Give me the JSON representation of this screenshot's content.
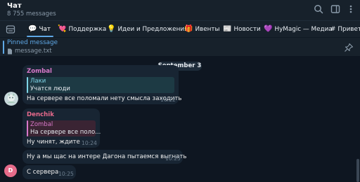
{
  "header": {
    "title": "Чат",
    "subtitle": "8 755 messages",
    "icons": [
      "search-icon",
      "sidebar-toggle-icon",
      "more-vertical-icon"
    ]
  },
  "tabs": {
    "items": [
      {
        "emoji": "💬",
        "label": "Чат"
      },
      {
        "emoji": "💘",
        "label": "Поддержка"
      },
      {
        "emoji": "💡",
        "label": "Идеи и Предложения"
      },
      {
        "emoji": "🎁",
        "label": "Ивенты"
      },
      {
        "emoji": "📰",
        "label": "Новости"
      },
      {
        "emoji": "💜",
        "label": "HyMagic — Медиа"
      },
      {
        "emoji": "#",
        "label": "Привет!"
      }
    ]
  },
  "pinned": {
    "title": "Pinned message",
    "text": "message.txt"
  },
  "chat": {
    "date": "September 3",
    "messages": [
      {
        "sender": "Zombal",
        "reply_name": "Лаки",
        "reply_text": "Учатся люди",
        "text": "На сервере все поломали нету смысла заходить",
        "time": "10:22"
      },
      {
        "sender": "Denchik",
        "reply_name": "Zombal",
        "reply_text": "На сервере все поло...",
        "text": "Ну чинят, ждите",
        "time": "10:24"
      },
      {
        "text": "Ну а мы щас на интере Дагона пытаемся выгнать",
        "time": "10:25"
      },
      {
        "text": "С сервера",
        "time": "10:25",
        "avatar_letter": "D"
      }
    ]
  },
  "colors": {
    "accent": "#5fa8e6",
    "zombal": "#d878c9",
    "lucky": "#7fd4e6",
    "denchik": "#e76a8c",
    "avatar_d": "#e66b8a"
  }
}
